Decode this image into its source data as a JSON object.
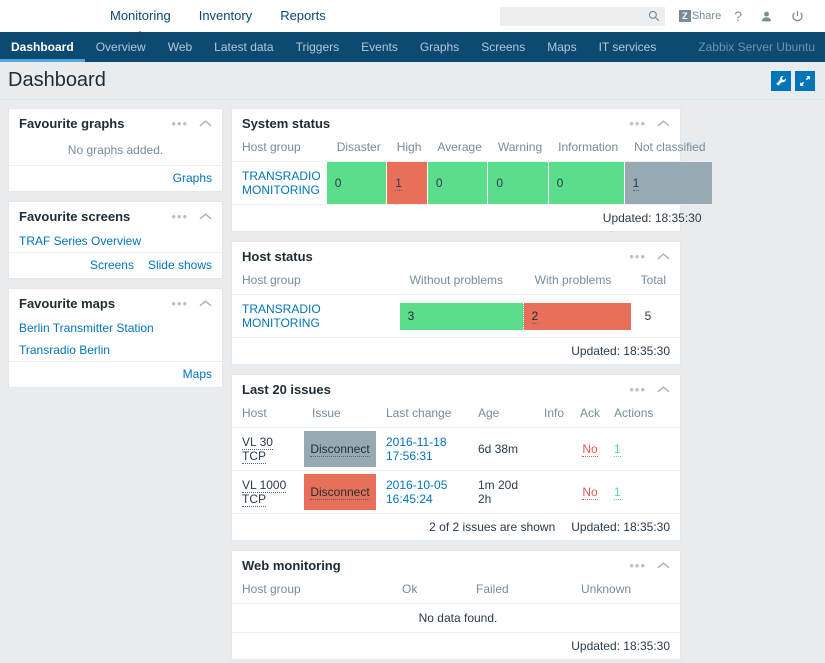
{
  "header": {
    "menu": [
      {
        "label": "Monitoring",
        "selected": true
      },
      {
        "label": "Inventory",
        "selected": false
      },
      {
        "label": "Reports",
        "selected": false
      }
    ],
    "search_placeholder": "",
    "search_value": "",
    "share_label": "Share",
    "help_label": "?",
    "user_label": "user",
    "signout_label": "sign out"
  },
  "nav": {
    "items": [
      {
        "label": "Dashboard",
        "active": true
      },
      {
        "label": "Overview",
        "active": false
      },
      {
        "label": "Web",
        "active": false
      },
      {
        "label": "Latest data",
        "active": false
      },
      {
        "label": "Triggers",
        "active": false
      },
      {
        "label": "Events",
        "active": false
      },
      {
        "label": "Graphs",
        "active": false
      },
      {
        "label": "Screens",
        "active": false
      },
      {
        "label": "Maps",
        "active": false
      },
      {
        "label": "IT services",
        "active": false
      }
    ],
    "server": "Zabbix Server Ubuntu"
  },
  "page": {
    "title": "Dashboard",
    "action_configure": "configure",
    "action_fullscreen": "fullscreen"
  },
  "favourite_graphs": {
    "title": "Favourite graphs",
    "empty": "No graphs added.",
    "footer_links": [
      "Graphs"
    ]
  },
  "favourite_screens": {
    "title": "Favourite screens",
    "items": [
      "TRAF Series Overview"
    ],
    "footer_links": [
      "Screens",
      "Slide shows"
    ]
  },
  "favourite_maps": {
    "title": "Favourite maps",
    "items": [
      "Berlin Transmitter Station",
      "Transradio Berlin"
    ],
    "footer_links": [
      "Maps"
    ]
  },
  "system_status": {
    "title": "System status",
    "columns": [
      "Host group",
      "Disaster",
      "High",
      "Average",
      "Warning",
      "Information",
      "Not classified"
    ],
    "rows": [
      {
        "host_group": "TRANSRADIO MONITORING",
        "cells": [
          {
            "value": "0",
            "color": "green",
            "link": false
          },
          {
            "value": "1",
            "color": "red",
            "link": true
          },
          {
            "value": "0",
            "color": "green",
            "link": false
          },
          {
            "value": "0",
            "color": "green",
            "link": false
          },
          {
            "value": "0",
            "color": "green",
            "link": false
          },
          {
            "value": "1",
            "color": "grey",
            "link": true
          }
        ]
      }
    ],
    "updated": "Updated: 18:35:30"
  },
  "host_status": {
    "title": "Host status",
    "columns": [
      "Host group",
      "Without problems",
      "With problems",
      "Total"
    ],
    "rows": [
      {
        "host_group": "TRANSRADIO MONITORING",
        "without_problems": "3",
        "with_problems": "2",
        "total": "5"
      }
    ],
    "updated": "Updated: 18:35:30"
  },
  "last_issues": {
    "title": "Last 20 issues",
    "columns": [
      "Host",
      "Issue",
      "Last change",
      "Age",
      "Info",
      "Ack",
      "Actions"
    ],
    "rows": [
      {
        "host": "VL 30 TCP",
        "issue": "Disconnect",
        "issue_color": "grey",
        "last_change_date": "2016-11-18",
        "last_change_time": "17:56:31",
        "age": "6d 38m",
        "info": "",
        "ack": "No",
        "actions": "1"
      },
      {
        "host": "VL 1000 TCP",
        "issue": "Disconnect",
        "issue_color": "red",
        "last_change_date": "2016-10-05",
        "last_change_time": "16:45:24",
        "age": "1m 20d 2h",
        "info": "",
        "ack": "No",
        "actions": "1"
      }
    ],
    "summary": "2 of 2 issues are shown",
    "updated": "Updated: 18:35:30"
  },
  "web_monitoring": {
    "title": "Web monitoring",
    "columns": [
      "Host group",
      "Ok",
      "Failed",
      "Unknown"
    ],
    "empty": "No data found.",
    "updated": "Updated: 18:35:30"
  },
  "colors": {
    "nav_bg": "#0d4a72",
    "accent": "#0275b8",
    "green": "#5cdd8b",
    "red": "#e8705a",
    "grey": "#97aab3",
    "ack_red": "#e45959"
  }
}
